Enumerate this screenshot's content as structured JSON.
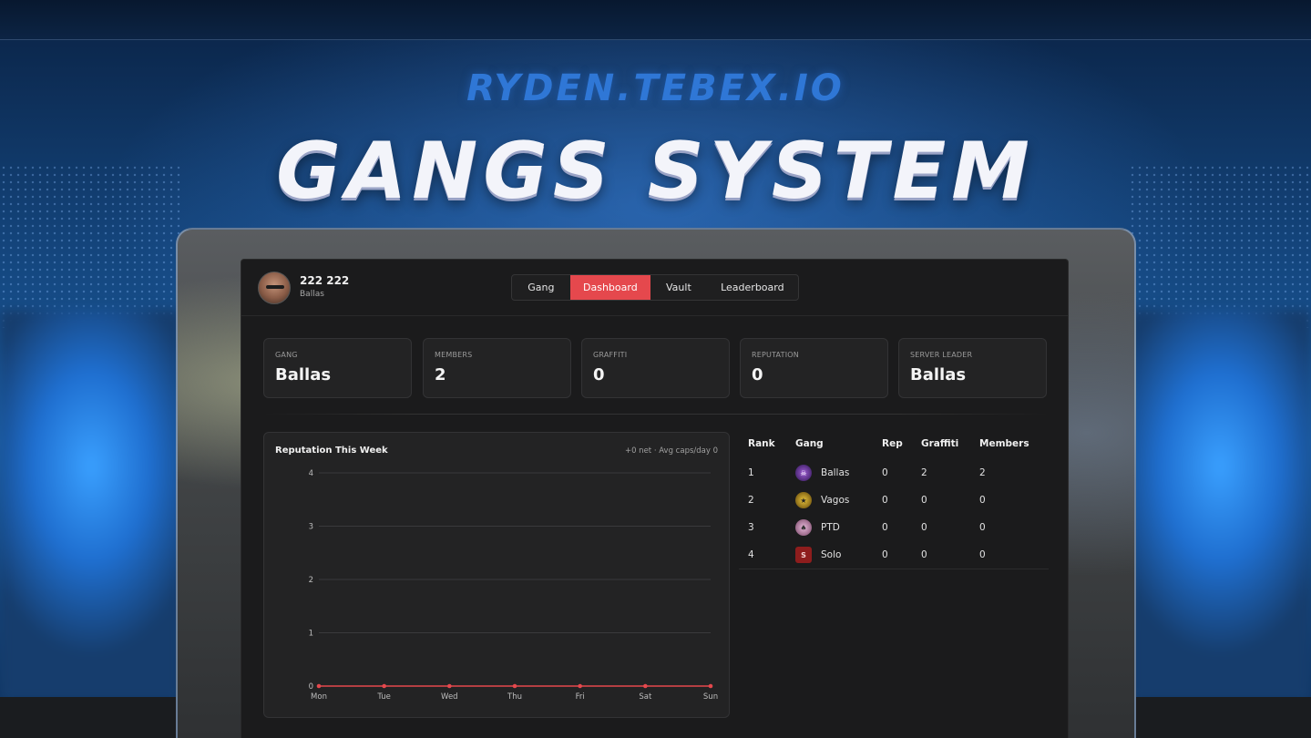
{
  "banner": {
    "brand": "RYDEN.TEBEX.IO",
    "headline": "GANGS SYSTEM"
  },
  "player": {
    "name": "222 222",
    "gang": "Ballas"
  },
  "tabs": [
    {
      "label": "Gang",
      "active": false
    },
    {
      "label": "Dashboard",
      "active": true
    },
    {
      "label": "Vault",
      "active": false
    },
    {
      "label": "Leaderboard",
      "active": false
    }
  ],
  "stats": [
    {
      "label": "GANG",
      "value": "Ballas"
    },
    {
      "label": "MEMBERS",
      "value": "2"
    },
    {
      "label": "GRAFFITI",
      "value": "0"
    },
    {
      "label": "REPUTATION",
      "value": "0"
    },
    {
      "label": "SERVER LEADER",
      "value": "Ballas"
    }
  ],
  "chart": {
    "title": "Reputation This Week",
    "subtitle": "+0 net · Avg caps/day 0"
  },
  "chart_data": {
    "type": "line",
    "categories": [
      "Mon",
      "Tue",
      "Wed",
      "Thu",
      "Fri",
      "Sat",
      "Sun"
    ],
    "series": [
      {
        "values": [
          0,
          0,
          0,
          0,
          0,
          0,
          0
        ]
      }
    ],
    "y_ticks": [
      "0",
      "1",
      "2",
      "3",
      "4"
    ],
    "ylim": [
      0,
      4
    ],
    "grid": true,
    "line_color": "#e5484d"
  },
  "leaderboard": {
    "headers": {
      "rank": "Rank",
      "gang": "Gang",
      "rep": "Rep",
      "graffiti": "Graffiti",
      "members": "Members"
    },
    "rows": [
      {
        "rank": "1",
        "gang": "Ballas",
        "icon": "ballas-icon",
        "rep": "0",
        "graffiti": "2",
        "members": "2"
      },
      {
        "rank": "2",
        "gang": "Vagos",
        "icon": "vagos-icon",
        "rep": "0",
        "graffiti": "0",
        "members": "0"
      },
      {
        "rank": "3",
        "gang": "PTD",
        "icon": "ptd-icon",
        "rep": "0",
        "graffiti": "0",
        "members": "0"
      },
      {
        "rank": "4",
        "gang": "Solo",
        "icon": "solo-icon",
        "icon_letter": "S",
        "rep": "0",
        "graffiti": "0",
        "members": "0"
      }
    ]
  },
  "colors": {
    "accent": "#e5484d",
    "panel": "#1b1b1c",
    "card": "#232324",
    "brand_blue": "#2f77d6"
  }
}
